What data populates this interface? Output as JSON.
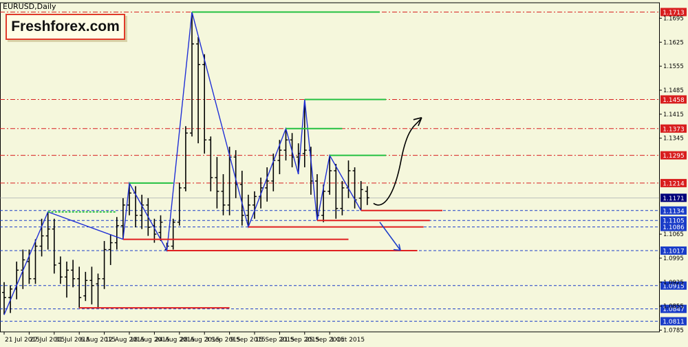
{
  "symbol_label": "EURUSD,Daily",
  "logo_text": "Freshforex.com",
  "colors": {
    "background": "#f5f7dc",
    "grid": "#1a3cc8",
    "candle": "#000000",
    "zigzag": "#1f2fd6",
    "support": "#e02020",
    "resistance": "#22c040",
    "level_red": "#d81e1e",
    "level_blue": "#1a3cc8",
    "current_price": "#00007a",
    "arrow_up": "#000000",
    "arrow_down": "#1a3cc8"
  },
  "chart_data": {
    "type": "candlestick",
    "symbol": "EURUSD",
    "timeframe": "Daily",
    "ylim": [
      1.078,
      1.172
    ],
    "y_ticks": [
      1.1695,
      1.1625,
      1.1555,
      1.1485,
      1.1415,
      1.1345,
      1.1065,
      1.0995,
      1.0925,
      1.0855,
      1.0785
    ],
    "x_ticks": [
      {
        "label": "21 Jul 2015",
        "index": 0
      },
      {
        "label": "27 Jul 2015",
        "index": 4
      },
      {
        "label": "31 Jul 2015",
        "index": 8
      },
      {
        "label": "6 Aug 2015",
        "index": 12
      },
      {
        "label": "12 Aug 2015",
        "index": 16
      },
      {
        "label": "18 Aug 2015",
        "index": 20
      },
      {
        "label": "24 Aug 2015",
        "index": 24
      },
      {
        "label": "28 Aug 2015",
        "index": 28
      },
      {
        "label": "3 Sep 2015",
        "index": 32
      },
      {
        "label": "9 Sep 2015",
        "index": 36
      },
      {
        "label": "15 Sep 2015",
        "index": 40
      },
      {
        "label": "21 Sep 2015",
        "index": 44
      },
      {
        "label": "25 Sep 2015",
        "index": 48
      },
      {
        "label": "1 Oct 2015",
        "index": 52
      }
    ],
    "levels": [
      {
        "price": 1.1713,
        "label": "1.1713",
        "style": "red"
      },
      {
        "price": 1.1458,
        "label": "1.1458",
        "style": "red"
      },
      {
        "price": 1.1373,
        "label": "1.1373",
        "style": "red"
      },
      {
        "price": 1.1295,
        "label": "1.1295",
        "style": "red"
      },
      {
        "price": 1.1214,
        "label": "1.1214",
        "style": "red"
      },
      {
        "price": 1.1134,
        "label": "1.1134",
        "style": "blue"
      },
      {
        "price": 1.1105,
        "label": "1.1105",
        "style": "blue"
      },
      {
        "price": 1.1086,
        "label": "1.1086",
        "style": "blue"
      },
      {
        "price": 1.1017,
        "label": "1.1017",
        "style": "blue"
      },
      {
        "price": 1.0915,
        "label": "1.0915",
        "style": "blue"
      },
      {
        "price": 1.0847,
        "label": "1.0847",
        "style": "blue"
      },
      {
        "price": 1.0811,
        "label": "1.0811",
        "style": "blue"
      }
    ],
    "current_price": {
      "price": 1.1171,
      "label": "1.1171"
    },
    "bars": [
      {
        "o": 1.0895,
        "h": 1.0925,
        "l": 1.083,
        "c": 1.088
      },
      {
        "o": 1.088,
        "h": 1.0915,
        "l": 1.0835,
        "c": 1.0905
      },
      {
        "o": 1.0905,
        "h": 1.0985,
        "l": 1.0875,
        "c": 1.096
      },
      {
        "o": 1.096,
        "h": 1.102,
        "l": 1.0905,
        "c": 1.099
      },
      {
        "o": 1.0985,
        "h": 1.102,
        "l": 1.092,
        "c": 1.0935
      },
      {
        "o": 1.0935,
        "h": 1.105,
        "l": 1.092,
        "c": 1.103
      },
      {
        "o": 1.103,
        "h": 1.111,
        "l": 1.1,
        "c": 1.106
      },
      {
        "o": 1.106,
        "h": 1.113,
        "l": 1.102,
        "c": 1.108
      },
      {
        "o": 1.108,
        "h": 1.111,
        "l": 1.095,
        "c": 1.0975
      },
      {
        "o": 1.098,
        "h": 1.1,
        "l": 1.092,
        "c": 1.094
      },
      {
        "o": 1.094,
        "h": 1.0985,
        "l": 1.088,
        "c": 1.096
      },
      {
        "o": 1.096,
        "h": 1.099,
        "l": 1.091,
        "c": 1.0935
      },
      {
        "o": 1.0935,
        "h": 1.097,
        "l": 1.085,
        "c": 1.088
      },
      {
        "o": 1.0885,
        "h": 1.0955,
        "l": 1.087,
        "c": 1.093
      },
      {
        "o": 1.093,
        "h": 1.097,
        "l": 1.086,
        "c": 1.0915
      },
      {
        "o": 1.092,
        "h": 1.095,
        "l": 1.085,
        "c": 1.0935
      },
      {
        "o": 1.0935,
        "h": 1.1045,
        "l": 1.0905,
        "c": 1.102
      },
      {
        "o": 1.102,
        "h": 1.1065,
        "l": 1.0975,
        "c": 1.104
      },
      {
        "o": 1.104,
        "h": 1.1115,
        "l": 1.102,
        "c": 1.109
      },
      {
        "o": 1.109,
        "h": 1.117,
        "l": 1.105,
        "c": 1.115
      },
      {
        "o": 1.115,
        "h": 1.1214,
        "l": 1.112,
        "c": 1.1185
      },
      {
        "o": 1.1185,
        "h": 1.1205,
        "l": 1.1085,
        "c": 1.112
      },
      {
        "o": 1.112,
        "h": 1.118,
        "l": 1.108,
        "c": 1.115
      },
      {
        "o": 1.115,
        "h": 1.117,
        "l": 1.106,
        "c": 1.1085
      },
      {
        "o": 1.109,
        "h": 1.111,
        "l": 1.104,
        "c": 1.1065
      },
      {
        "o": 1.107,
        "h": 1.112,
        "l": 1.1045,
        "c": 1.11
      },
      {
        "o": 1.102,
        "h": 1.104,
        "l": 1.1017,
        "c": 1.103
      },
      {
        "o": 1.103,
        "h": 1.111,
        "l": 1.102,
        "c": 1.11
      },
      {
        "o": 1.11,
        "h": 1.1215,
        "l": 1.109,
        "c": 1.12
      },
      {
        "o": 1.12,
        "h": 1.138,
        "l": 1.119,
        "c": 1.136
      },
      {
        "o": 1.136,
        "h": 1.1713,
        "l": 1.135,
        "c": 1.162
      },
      {
        "o": 1.162,
        "h": 1.164,
        "l": 1.133,
        "c": 1.156
      },
      {
        "o": 1.156,
        "h": 1.159,
        "l": 1.13,
        "c": 1.134
      },
      {
        "o": 1.134,
        "h": 1.135,
        "l": 1.119,
        "c": 1.123
      },
      {
        "o": 1.123,
        "h": 1.129,
        "l": 1.114,
        "c": 1.119
      },
      {
        "o": 1.119,
        "h": 1.124,
        "l": 1.112,
        "c": 1.115
      },
      {
        "o": 1.115,
        "h": 1.132,
        "l": 1.112,
        "c": 1.129
      },
      {
        "o": 1.129,
        "h": 1.131,
        "l": 1.117,
        "c": 1.121
      },
      {
        "o": 1.121,
        "h": 1.125,
        "l": 1.109,
        "c": 1.112
      },
      {
        "o": 1.112,
        "h": 1.118,
        "l": 1.1086,
        "c": 1.115
      },
      {
        "o": 1.115,
        "h": 1.119,
        "l": 1.111,
        "c": 1.1175
      },
      {
        "o": 1.1175,
        "h": 1.123,
        "l": 1.114,
        "c": 1.12
      },
      {
        "o": 1.12,
        "h": 1.126,
        "l": 1.116,
        "c": 1.122
      },
      {
        "o": 1.122,
        "h": 1.13,
        "l": 1.119,
        "c": 1.128
      },
      {
        "o": 1.128,
        "h": 1.134,
        "l": 1.124,
        "c": 1.131
      },
      {
        "o": 1.131,
        "h": 1.1373,
        "l": 1.128,
        "c": 1.134
      },
      {
        "o": 1.134,
        "h": 1.136,
        "l": 1.126,
        "c": 1.129
      },
      {
        "o": 1.129,
        "h": 1.133,
        "l": 1.124,
        "c": 1.13
      },
      {
        "o": 1.13,
        "h": 1.1458,
        "l": 1.126,
        "c": 1.131
      },
      {
        "o": 1.131,
        "h": 1.132,
        "l": 1.118,
        "c": 1.122
      },
      {
        "o": 1.122,
        "h": 1.124,
        "l": 1.1105,
        "c": 1.112
      },
      {
        "o": 1.112,
        "h": 1.121,
        "l": 1.11,
        "c": 1.119
      },
      {
        "o": 1.119,
        "h": 1.1295,
        "l": 1.118,
        "c": 1.125
      },
      {
        "o": 1.125,
        "h": 1.127,
        "l": 1.111,
        "c": 1.114
      },
      {
        "o": 1.114,
        "h": 1.122,
        "l": 1.112,
        "c": 1.12
      },
      {
        "o": 1.12,
        "h": 1.128,
        "l": 1.117,
        "c": 1.125
      },
      {
        "o": 1.125,
        "h": 1.126,
        "l": 1.114,
        "c": 1.1165
      },
      {
        "o": 1.117,
        "h": 1.122,
        "l": 1.1134,
        "c": 1.1195
      },
      {
        "o": 1.119,
        "h": 1.1205,
        "l": 1.115,
        "c": 1.1171
      }
    ]
  }
}
